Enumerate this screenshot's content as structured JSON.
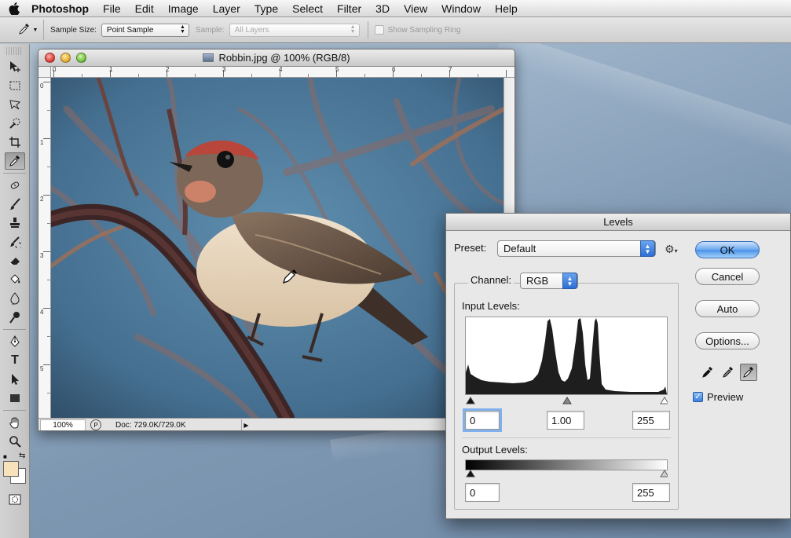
{
  "menubar": {
    "app_name": "Photoshop",
    "items": [
      "File",
      "Edit",
      "Image",
      "Layer",
      "Type",
      "Select",
      "Filter",
      "3D",
      "View",
      "Window",
      "Help"
    ]
  },
  "options_bar": {
    "sample_size_label": "Sample Size:",
    "sample_size_value": "Point Sample",
    "sample_label": "Sample:",
    "sample_value": "All Layers",
    "show_ring_label": "Show Sampling Ring"
  },
  "document": {
    "title": "Robbin.jpg @ 100% (RGB/8)",
    "hruler_numbers": [
      "0",
      "1",
      "2",
      "3",
      "4",
      "5",
      "6",
      "7"
    ],
    "vruler_numbers": [
      "0",
      "1",
      "2",
      "3",
      "4",
      "5"
    ],
    "zoom": "100%",
    "doc_size": "Doc: 729.0K/729.0K"
  },
  "levels": {
    "title": "Levels",
    "preset_label": "Preset:",
    "preset_value": "Default",
    "channel_label": "Channel:",
    "channel_value": "RGB",
    "input_levels_label": "Input Levels:",
    "input_black": "0",
    "input_gamma": "1.00",
    "input_white": "255",
    "output_levels_label": "Output Levels:",
    "output_black": "0",
    "output_white": "255",
    "buttons": {
      "ok": "OK",
      "cancel": "Cancel",
      "auto": "Auto",
      "options": "Options..."
    },
    "preview_label": "Preview",
    "preview_checked": true
  },
  "colors": {
    "foreground": "#f7e2bb",
    "background": "#ffffff",
    "accent": "#4a90e6"
  }
}
